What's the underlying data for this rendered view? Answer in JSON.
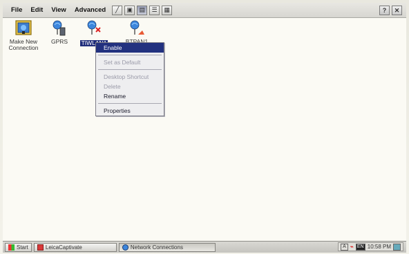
{
  "menubar": {
    "items": [
      "File",
      "Edit",
      "View",
      "Advanced"
    ],
    "tools": [
      {
        "icon": "diagonal-line-icon",
        "glyph": "╱"
      },
      {
        "icon": "monitor-icon",
        "glyph": "▣"
      },
      {
        "icon": "small-icons-view-icon",
        "glyph": "▤"
      },
      {
        "icon": "list-view-icon",
        "glyph": "☰"
      },
      {
        "icon": "details-view-icon",
        "glyph": "▦"
      }
    ],
    "help_label": "?",
    "close_label": "✕"
  },
  "icons": [
    {
      "name": "make-new-connection-icon",
      "label": "Make New Connection"
    },
    {
      "name": "gprs-connection-icon",
      "label": "GPRS"
    },
    {
      "name": "tiwlan-connection-icon",
      "label": "TIWLAN1",
      "selected": true
    },
    {
      "name": "btpan-connection-icon",
      "label": "BTPAN1"
    }
  ],
  "context_menu": {
    "items": [
      {
        "label": "Enable",
        "state": "active"
      },
      {
        "sep": true
      },
      {
        "label": "Set as Default",
        "state": "disabled"
      },
      {
        "sep": true
      },
      {
        "label": "Desktop Shortcut",
        "state": "disabled"
      },
      {
        "label": "Delete",
        "state": "disabled"
      },
      {
        "label": "Rename",
        "state": "normal"
      },
      {
        "sep": true
      },
      {
        "label": "Properties",
        "state": "normal"
      }
    ]
  },
  "taskbar": {
    "start_label": "Start",
    "leica_label": "LeicaCaptivate",
    "network_label": "Network Connections",
    "time": "10:58 PM",
    "lang": "EN"
  },
  "colors": {
    "selection": "#22317f",
    "background": "#fbfaf4"
  }
}
